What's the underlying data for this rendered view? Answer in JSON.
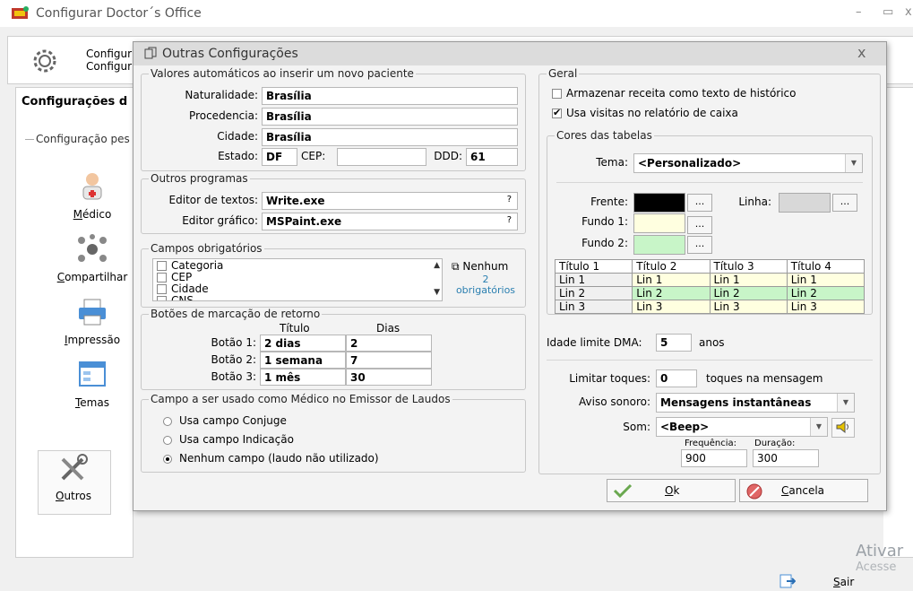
{
  "main": {
    "title": "Configurar Doctor´s Office",
    "top_line1": "Configur",
    "top_line2": "Configur",
    "section_title": "Configurações d",
    "section_sub": "Configuração pes",
    "nav": [
      {
        "label": "Médico",
        "hot": "M",
        "rest": "édico",
        "icon": "doctor-icon"
      },
      {
        "label": "Compartilhar",
        "hot": "C",
        "rest": "ompartilhar",
        "icon": "network-icon"
      },
      {
        "label": "Impressão",
        "hot": "I",
        "rest": "mpressão",
        "icon": "printer-icon"
      },
      {
        "label": "Temas",
        "hot": "T",
        "rest": "emas",
        "icon": "themes-icon"
      },
      {
        "label": "Outros",
        "hot": "O",
        "rest": "utros",
        "icon": "tools-icon"
      }
    ],
    "exit_hot": "S",
    "exit_rest": "air",
    "watermark1": "Ativar",
    "watermark2": "Acesse"
  },
  "dialog": {
    "title": "Outras Configurações",
    "close": "x",
    "auto_values": {
      "legend": "Valores automáticos ao inserir um novo paciente",
      "naturalidade_label": "Naturalidade:",
      "naturalidade": "Brasília",
      "procedencia_label": "Procedencia:",
      "procedencia": "Brasília",
      "cidade_label": "Cidade:",
      "cidade": "Brasília",
      "estado_label": "Estado:",
      "estado": "DF",
      "cep_label": "CEP:",
      "cep": "",
      "ddd_label": "DDD:",
      "ddd": "61"
    },
    "programs": {
      "legend": "Outros programas",
      "text_editor_label": "Editor de textos:",
      "text_editor": "Write.exe",
      "graphic_editor_label": "Editor gráfico:",
      "graphic_editor": "MSPaint.exe",
      "browse": "?"
    },
    "required": {
      "legend": "Campos obrigatórios",
      "items": [
        "Categoria",
        "CEP",
        "Cidade",
        "CNS"
      ],
      "none_label": "Nenhum",
      "count_line1": "2",
      "count_line2": "obrigatórios"
    },
    "return_buttons": {
      "legend": "Botões de marcação de retorno",
      "col_title": "Título",
      "col_days": "Dias",
      "rows": [
        {
          "label": "Botão 1:",
          "title": "2 dias",
          "days": "2"
        },
        {
          "label": "Botão 2:",
          "title": "1 semana",
          "days": "7"
        },
        {
          "label": "Botão 3:",
          "title": "1 mês",
          "days": "30"
        }
      ]
    },
    "doctor_field": {
      "legend": "Campo a ser usado como Médico no Emissor de Laudos",
      "options": [
        "Usa campo Conjuge",
        "Usa campo Indicação",
        "Nenhum campo (laudo não utilizado)"
      ],
      "selected": 2
    },
    "general": {
      "legend": "Geral",
      "check1": "Armazenar receita como texto de histórico",
      "check1_on": false,
      "check2": "Usa visitas no relatório de caixa",
      "check2_on": true
    },
    "table_colors": {
      "legend": "Cores das tabelas",
      "theme_label": "Tema:",
      "theme": "<Personalizado>",
      "front_label": "Frente:",
      "line_label": "Linha:",
      "bg1_label": "Fundo 1:",
      "bg2_label": "Fundo 2:",
      "dots": "...",
      "colors": {
        "front": "#000000",
        "line": "#d8d8d8",
        "bg1": "#ffffe0",
        "bg2": "#c8f5c8"
      },
      "preview_header": [
        "Título 1",
        "Título 2",
        "Título 3",
        "Título 4"
      ],
      "preview_rows": [
        [
          "Lin 1",
          "Lin 1",
          "Lin 1",
          "Lin 1"
        ],
        [
          "Lin 2",
          "Lin 2",
          "Lin 2",
          "Lin 2"
        ],
        [
          "Lin 3",
          "Lin 3",
          "Lin 3",
          "Lin 3"
        ]
      ]
    },
    "dma": {
      "label": "Idade limite DMA:",
      "value": "5",
      "unit": "anos"
    },
    "touches": {
      "label": "Limitar toques:",
      "value": "0",
      "unit": "toques na mensagem"
    },
    "sound_alert": {
      "label": "Aviso sonoro:",
      "value": "Mensagens instantâneas"
    },
    "sound": {
      "label": "Som:",
      "value": "<Beep>",
      "freq_label": "Frequência:",
      "freq": "900",
      "dur_label": "Duração:",
      "dur": "300"
    },
    "ok_hot": "O",
    "ok_rest": "k",
    "cancel_hot": "C",
    "cancel_rest": "ancela"
  }
}
